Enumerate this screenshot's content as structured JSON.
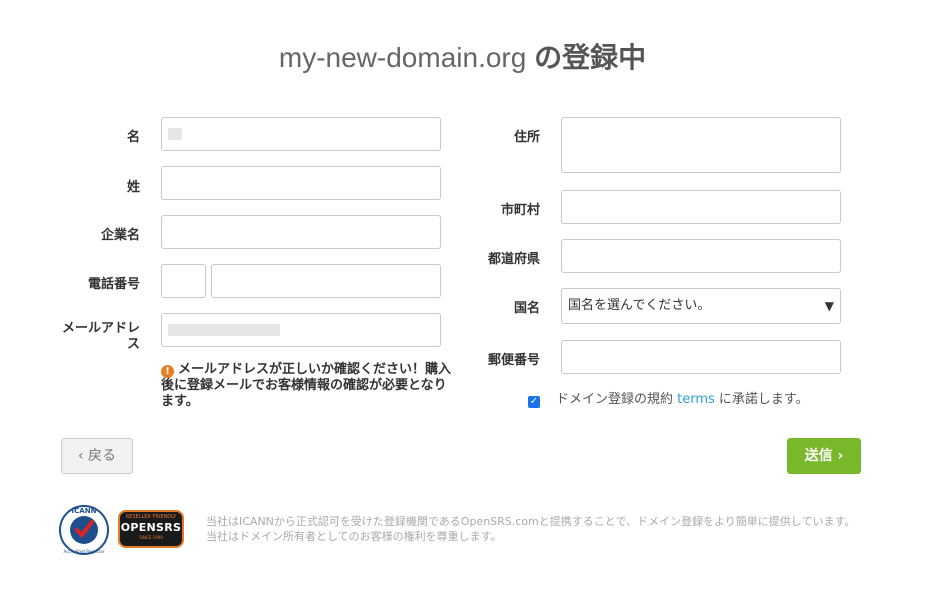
{
  "page": {
    "title_domain": "my-new-domain.org",
    "title_suffix": " の登録中"
  },
  "form": {
    "first_name_label": "名",
    "last_name_label": "姓",
    "company_label": "企業名",
    "phone_label": "電話番号",
    "email_label": "メールアドレス",
    "address_label": "住所",
    "city_label": "市町村",
    "state_label": "都道府県",
    "country_label": "国名",
    "country_value": "国名を選んでください。",
    "postal_label": "郵便番号"
  },
  "notice": {
    "icon": "info-icon",
    "text": "メールアドレスが正しいか確認ください！購入後に登録メールでお客様情報の確認が必要となります。"
  },
  "agreement": {
    "checked": true,
    "before": "ドメイン登録の規約 ",
    "link": "terms",
    "after": " に承諾します。"
  },
  "buttons": {
    "back": "戻る",
    "send": "送信"
  },
  "footer": {
    "line1": "当社はICANNから正式認可を受けた登録機関であるOpenSRS.comと提携することで、ドメイン登録をより簡単に提供しています。",
    "line2": "当社はドメイン所有者としてのお客様の権利を尊重します。",
    "icann_logo_text": "ICANN",
    "icann_logo_sub": "Accredited Registrar",
    "opensrs_logo_top": "RESELLER FRIENDLY",
    "opensrs_logo_name": "OPENSRS",
    "opensrs_logo_sub": "SINCE 1999"
  },
  "colors": {
    "accent_green": "#7ab82b",
    "link_blue": "#2a9fd6",
    "warning_orange": "#e77e23"
  }
}
